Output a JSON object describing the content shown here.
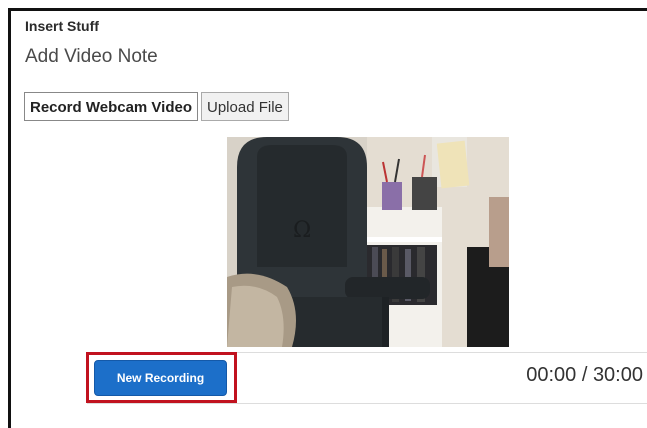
{
  "dialog": {
    "title": "Insert Stuff",
    "heading": "Add Video Note"
  },
  "tabs": [
    {
      "label": "Record Webcam Video",
      "active": true
    },
    {
      "label": "Upload File",
      "active": false
    }
  ],
  "recorder": {
    "new_recording_label": "New Recording",
    "timer": "00:00 / 30:00",
    "button_color": "#1c6fc9",
    "highlight_color": "#c1121f"
  },
  "preview": {
    "icon": "webcam-preview"
  }
}
